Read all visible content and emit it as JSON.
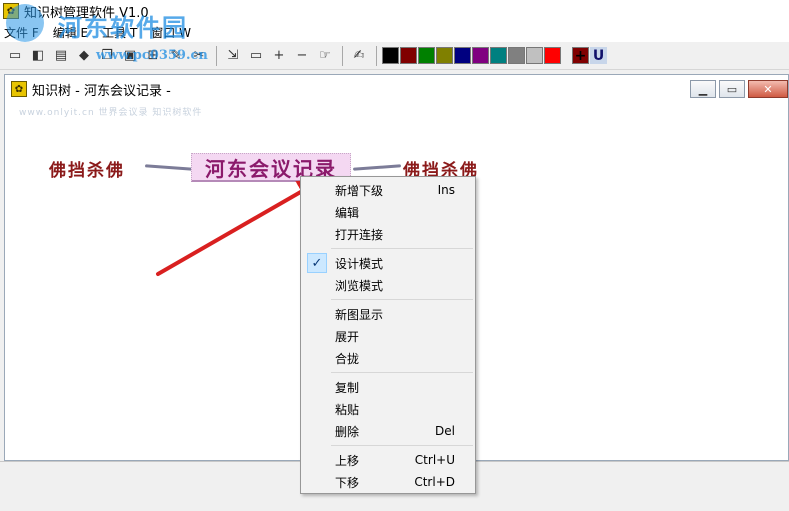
{
  "app": {
    "title": "知识树管理软件 V1.0",
    "icon": "knowledge-tree-app-icon"
  },
  "menubar": {
    "items": [
      {
        "label": "文件 F"
      },
      {
        "label": "编辑 E"
      },
      {
        "label": "工具 T"
      },
      {
        "label": "窗口 W"
      }
    ]
  },
  "toolbar": {
    "buttons": [
      "new-icon",
      "open-icon",
      "save-icon",
      "cut-icon",
      "copy-icon",
      "paste-icon",
      "tree-icon",
      "pin-icon",
      "scissors-icon",
      "import-icon",
      "window-icon",
      "plus-icon",
      "minus-icon",
      "pointer-icon",
      "text-tool-icon"
    ],
    "colors": [
      "#000000",
      "#800000",
      "#008000",
      "#808000",
      "#000080",
      "#800080",
      "#008080",
      "#808080",
      "#c0c0c0",
      "#ff0000"
    ],
    "extra": {
      "swatch_color": "#800000",
      "swatch_label": "+",
      "underline_label": "U"
    }
  },
  "watermark": {
    "brand": "河东软件园",
    "url": "www.pc0359.cn"
  },
  "child_window": {
    "title": "知识树 - 河东会议记录 -",
    "faint_text": "www.onlyit.cn 世界会议录 知识树软件"
  },
  "canvas": {
    "main_node": "河东会议记录",
    "left_node": "佛挡杀佛",
    "right_node": "佛挡杀佛"
  },
  "context_menu": {
    "groups": [
      [
        {
          "label": "新增下级",
          "shortcut": "Ins"
        },
        {
          "label": "编辑",
          "shortcut": ""
        },
        {
          "label": "打开连接",
          "shortcut": ""
        }
      ],
      [
        {
          "label": "设计模式",
          "shortcut": "",
          "checked": true
        },
        {
          "label": "浏览模式",
          "shortcut": ""
        }
      ],
      [
        {
          "label": "新图显示",
          "shortcut": ""
        },
        {
          "label": "展开",
          "shortcut": ""
        },
        {
          "label": "合拢",
          "shortcut": ""
        }
      ],
      [
        {
          "label": "复制",
          "shortcut": ""
        },
        {
          "label": "粘贴",
          "shortcut": ""
        },
        {
          "label": "删除",
          "shortcut": "Del"
        }
      ],
      [
        {
          "label": "上移",
          "shortcut": "Ctrl+U"
        },
        {
          "label": "下移",
          "shortcut": "Ctrl+D"
        }
      ]
    ]
  },
  "annotation": {
    "arrow_color": "#d92020"
  }
}
